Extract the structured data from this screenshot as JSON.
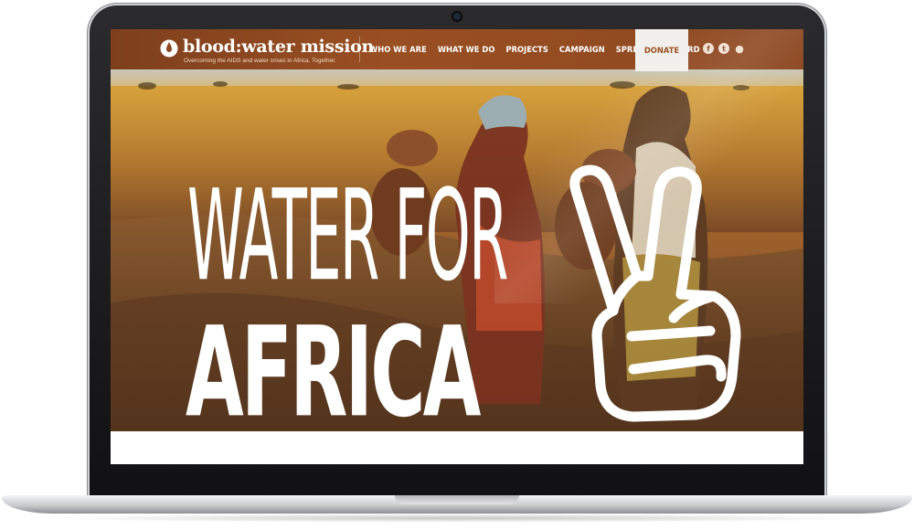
{
  "site": {
    "logo_text": "blood:water mission",
    "tagline": "Overcoming the AIDS and water crises in Africa. Together."
  },
  "nav": {
    "items": [
      {
        "label": "WHO WE ARE"
      },
      {
        "label": "WHAT WE DO"
      },
      {
        "label": "PROJECTS"
      },
      {
        "label": "CAMPAIGN"
      },
      {
        "label": "SPREAD THE WORD"
      }
    ],
    "donate_label": "DONATE",
    "social": [
      {
        "icon": "facebook-icon",
        "glyph": "f"
      },
      {
        "icon": "twitter-icon",
        "glyph": "t"
      },
      {
        "icon": "chat-bubble-icon",
        "glyph": "●"
      }
    ]
  },
  "hero": {
    "line1": "WATER FOR",
    "line2": "AFRICA",
    "graphic_icon": "peace-sign-hand-icon"
  },
  "colors": {
    "nav_brown": "#8c4720",
    "donate_bg": "#f2f0ec",
    "headline": "#ffffff"
  }
}
